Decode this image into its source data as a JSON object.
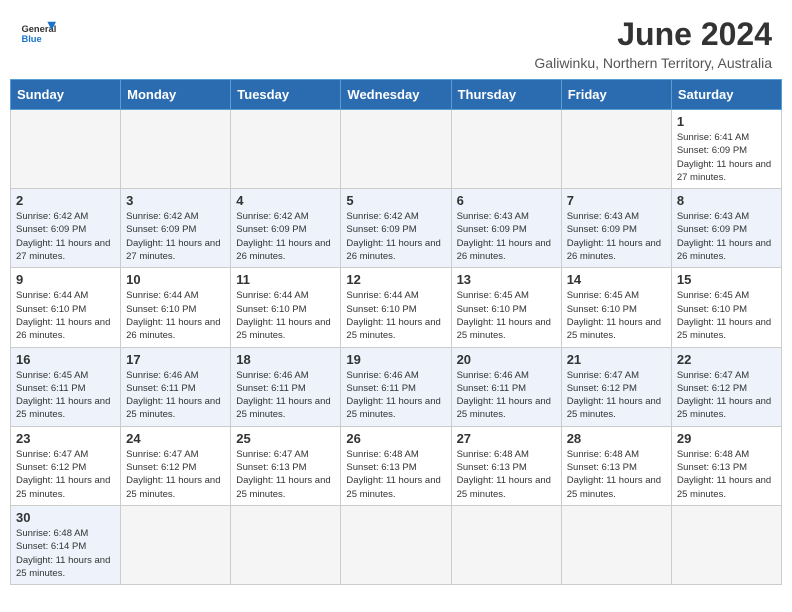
{
  "header": {
    "logo_general": "General",
    "logo_blue": "Blue",
    "month": "June 2024",
    "location": "Galiwinku, Northern Territory, Australia"
  },
  "weekdays": [
    "Sunday",
    "Monday",
    "Tuesday",
    "Wednesday",
    "Thursday",
    "Friday",
    "Saturday"
  ],
  "weeks": [
    [
      {
        "day": "",
        "empty": true
      },
      {
        "day": "",
        "empty": true
      },
      {
        "day": "",
        "empty": true
      },
      {
        "day": "",
        "empty": true
      },
      {
        "day": "",
        "empty": true
      },
      {
        "day": "",
        "empty": true
      },
      {
        "day": "1",
        "sunrise": "6:41 AM",
        "sunset": "6:09 PM",
        "daylight": "11 hours and 27 minutes."
      }
    ],
    [
      {
        "day": "2",
        "sunrise": "6:42 AM",
        "sunset": "6:09 PM",
        "daylight": "11 hours and 27 minutes."
      },
      {
        "day": "3",
        "sunrise": "6:42 AM",
        "sunset": "6:09 PM",
        "daylight": "11 hours and 27 minutes."
      },
      {
        "day": "4",
        "sunrise": "6:42 AM",
        "sunset": "6:09 PM",
        "daylight": "11 hours and 26 minutes."
      },
      {
        "day": "5",
        "sunrise": "6:42 AM",
        "sunset": "6:09 PM",
        "daylight": "11 hours and 26 minutes."
      },
      {
        "day": "6",
        "sunrise": "6:43 AM",
        "sunset": "6:09 PM",
        "daylight": "11 hours and 26 minutes."
      },
      {
        "day": "7",
        "sunrise": "6:43 AM",
        "sunset": "6:09 PM",
        "daylight": "11 hours and 26 minutes."
      },
      {
        "day": "8",
        "sunrise": "6:43 AM",
        "sunset": "6:09 PM",
        "daylight": "11 hours and 26 minutes."
      }
    ],
    [
      {
        "day": "9",
        "sunrise": "6:44 AM",
        "sunset": "6:10 PM",
        "daylight": "11 hours and 26 minutes."
      },
      {
        "day": "10",
        "sunrise": "6:44 AM",
        "sunset": "6:10 PM",
        "daylight": "11 hours and 26 minutes."
      },
      {
        "day": "11",
        "sunrise": "6:44 AM",
        "sunset": "6:10 PM",
        "daylight": "11 hours and 25 minutes."
      },
      {
        "day": "12",
        "sunrise": "6:44 AM",
        "sunset": "6:10 PM",
        "daylight": "11 hours and 25 minutes."
      },
      {
        "day": "13",
        "sunrise": "6:45 AM",
        "sunset": "6:10 PM",
        "daylight": "11 hours and 25 minutes."
      },
      {
        "day": "14",
        "sunrise": "6:45 AM",
        "sunset": "6:10 PM",
        "daylight": "11 hours and 25 minutes."
      },
      {
        "day": "15",
        "sunrise": "6:45 AM",
        "sunset": "6:10 PM",
        "daylight": "11 hours and 25 minutes."
      }
    ],
    [
      {
        "day": "16",
        "sunrise": "6:45 AM",
        "sunset": "6:11 PM",
        "daylight": "11 hours and 25 minutes."
      },
      {
        "day": "17",
        "sunrise": "6:46 AM",
        "sunset": "6:11 PM",
        "daylight": "11 hours and 25 minutes."
      },
      {
        "day": "18",
        "sunrise": "6:46 AM",
        "sunset": "6:11 PM",
        "daylight": "11 hours and 25 minutes."
      },
      {
        "day": "19",
        "sunrise": "6:46 AM",
        "sunset": "6:11 PM",
        "daylight": "11 hours and 25 minutes."
      },
      {
        "day": "20",
        "sunrise": "6:46 AM",
        "sunset": "6:11 PM",
        "daylight": "11 hours and 25 minutes."
      },
      {
        "day": "21",
        "sunrise": "6:47 AM",
        "sunset": "6:12 PM",
        "daylight": "11 hours and 25 minutes."
      },
      {
        "day": "22",
        "sunrise": "6:47 AM",
        "sunset": "6:12 PM",
        "daylight": "11 hours and 25 minutes."
      }
    ],
    [
      {
        "day": "23",
        "sunrise": "6:47 AM",
        "sunset": "6:12 PM",
        "daylight": "11 hours and 25 minutes."
      },
      {
        "day": "24",
        "sunrise": "6:47 AM",
        "sunset": "6:12 PM",
        "daylight": "11 hours and 25 minutes."
      },
      {
        "day": "25",
        "sunrise": "6:47 AM",
        "sunset": "6:13 PM",
        "daylight": "11 hours and 25 minutes."
      },
      {
        "day": "26",
        "sunrise": "6:48 AM",
        "sunset": "6:13 PM",
        "daylight": "11 hours and 25 minutes."
      },
      {
        "day": "27",
        "sunrise": "6:48 AM",
        "sunset": "6:13 PM",
        "daylight": "11 hours and 25 minutes."
      },
      {
        "day": "28",
        "sunrise": "6:48 AM",
        "sunset": "6:13 PM",
        "daylight": "11 hours and 25 minutes."
      },
      {
        "day": "29",
        "sunrise": "6:48 AM",
        "sunset": "6:13 PM",
        "daylight": "11 hours and 25 minutes."
      }
    ],
    [
      {
        "day": "30",
        "sunrise": "6:48 AM",
        "sunset": "6:14 PM",
        "daylight": "11 hours and 25 minutes."
      },
      {
        "day": "",
        "empty": true
      },
      {
        "day": "",
        "empty": true
      },
      {
        "day": "",
        "empty": true
      },
      {
        "day": "",
        "empty": true
      },
      {
        "day": "",
        "empty": true
      },
      {
        "day": "",
        "empty": true
      }
    ]
  ],
  "labels": {
    "sunrise": "Sunrise:",
    "sunset": "Sunset:",
    "daylight": "Daylight:"
  }
}
